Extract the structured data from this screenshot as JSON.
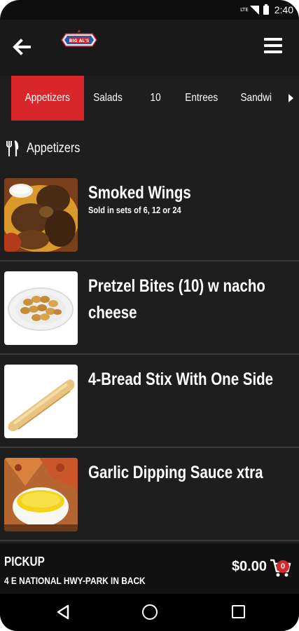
{
  "status_bar": {
    "network": "LTE",
    "time": "2:40"
  },
  "header": {
    "back_icon": "arrow-left-icon",
    "menu_icon": "hamburger-menu-icon",
    "logo_text": "BIG AL'S"
  },
  "tabs": [
    {
      "label": "Appetizers",
      "active": true
    },
    {
      "label": "Salads",
      "active": false
    },
    {
      "label": "10",
      "active": false
    },
    {
      "label": "Entrees",
      "active": false
    },
    {
      "label": "Sandwi",
      "active": false
    }
  ],
  "section": {
    "icon": "fork-knife-icon",
    "title": "Appetizers"
  },
  "items": [
    {
      "title": "Smoked Wings",
      "description": "Sold in sets of 6, 12 or 24",
      "image": "wings-photo"
    },
    {
      "title": "Pretzel Bites (10) w nacho cheese",
      "description": "",
      "image": "pretzel-bites-photo"
    },
    {
      "title": "4-Bread Stix With One Side",
      "description": "",
      "image": "breadstick-photo"
    },
    {
      "title": "Garlic Dipping Sauce xtra",
      "description": "",
      "image": "garlic-sauce-photo"
    }
  ],
  "footer": {
    "mode": "PICKUP",
    "address": "4 E NATIONAL HWY-PARK IN BACK",
    "total": "$0.00",
    "cart_count": "0"
  },
  "colors": {
    "accent": "#d8262b",
    "background": "#1e1e1e",
    "header": "#191919"
  }
}
